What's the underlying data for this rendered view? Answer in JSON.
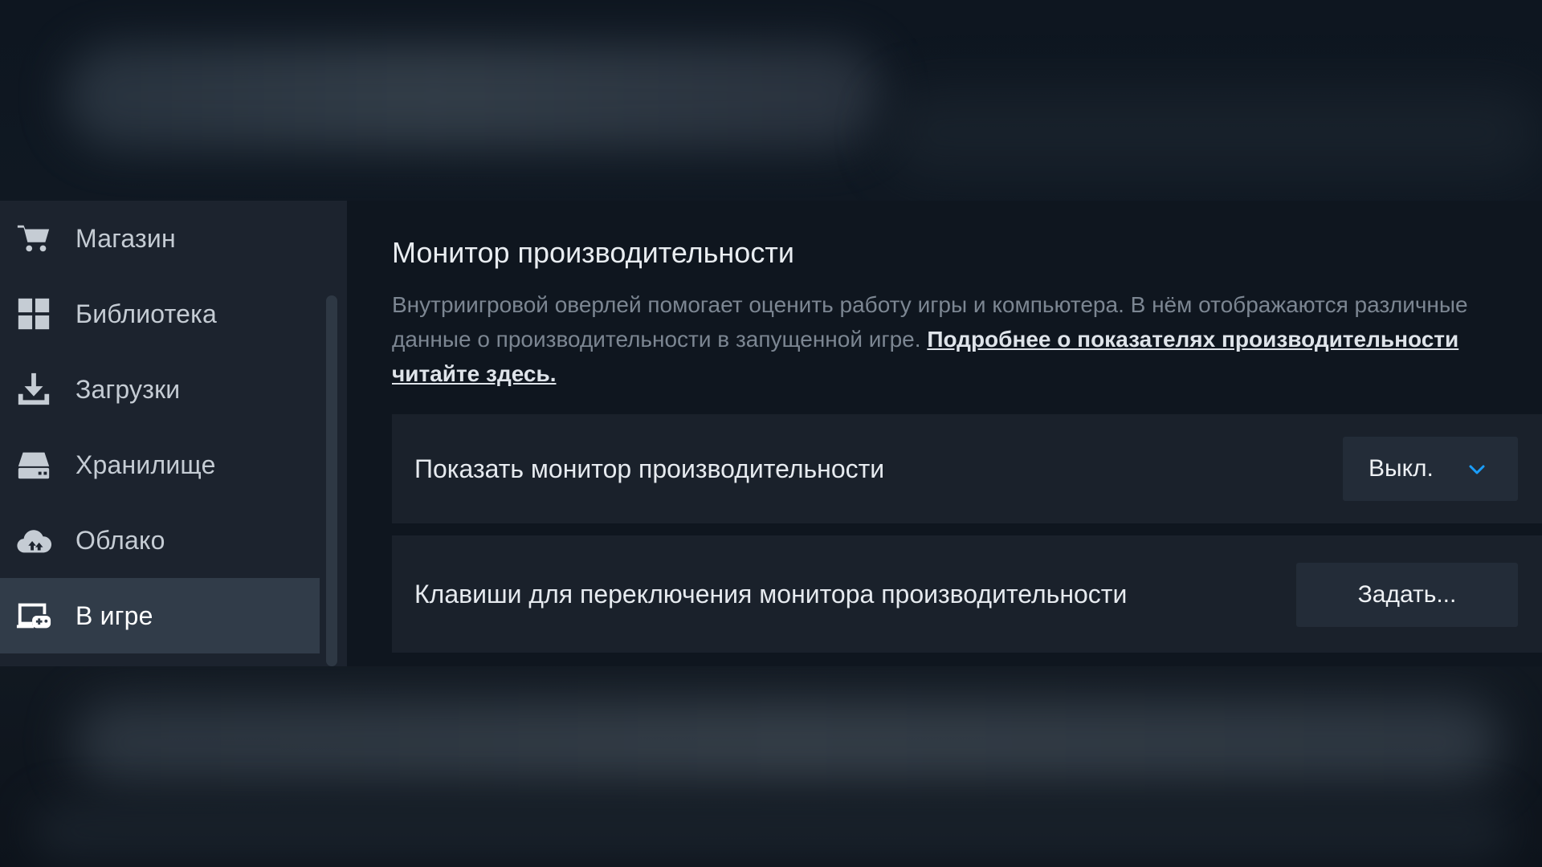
{
  "sidebar": {
    "items": [
      {
        "label": "Магазин",
        "icon": "cart-icon",
        "active": false
      },
      {
        "label": "Библиотека",
        "icon": "grid-icon",
        "active": false
      },
      {
        "label": "Загрузки",
        "icon": "download-icon",
        "active": false
      },
      {
        "label": "Хранилище",
        "icon": "storage-drive-icon",
        "active": false
      },
      {
        "label": "Облако",
        "icon": "cloud-sync-icon",
        "active": false
      },
      {
        "label": "В игре",
        "icon": "in-game-icon",
        "active": true
      }
    ]
  },
  "main": {
    "title": "Монитор производительности",
    "description": "Внутриигровой оверлей помогает оценить работу игры и компьютера. В нём отображаются различные данные о производительности в запущенной игре.",
    "link_text": "Подробнее о показателях производительности читайте здесь.",
    "settings": [
      {
        "label": "Показать монитор производительности",
        "control": "dropdown",
        "value": "Выкл."
      },
      {
        "label": "Клавиши для переключения монитора производительности",
        "control": "button",
        "value": "Задать..."
      }
    ]
  },
  "colors": {
    "sidebar_bg": "#1c232e",
    "sidebar_active": "#313c49",
    "panel_bg": "#0f161f",
    "row_bg": "#1a212b",
    "control_bg": "#232c38",
    "accent": "#1a9fff"
  }
}
